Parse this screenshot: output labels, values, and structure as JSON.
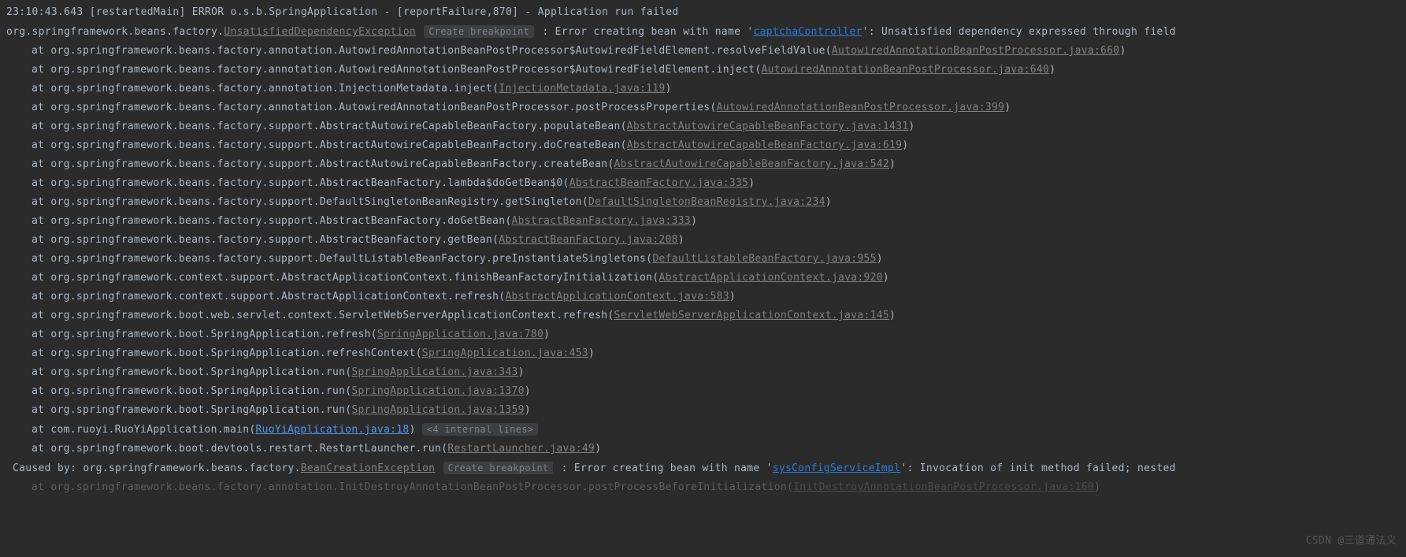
{
  "header": {
    "timestamp": "23:10:43.643",
    "thread": "[restartedMain]",
    "level": "ERROR",
    "logger": "o.s.b.SpringApplication",
    "dash": "-",
    "location": "[reportFailure,870]",
    "dash2": "-",
    "message": "Application run failed"
  },
  "exception_line": {
    "package": "org.springframework.beans.factory.",
    "exception_class": "UnsatisfiedDependencyException",
    "breakpoint": "Create breakpoint",
    "prefix": ": Error creating bean with name '",
    "bean_link": "captchaController",
    "suffix": "': Unsatisfied dependency expressed through field"
  },
  "stack": [
    {
      "pkg": "org.springframework.beans.factory.annotation.AutowiredAnnotationBeanPostProcessor$AutowiredFieldElement.resolveFieldValue(",
      "link": "AutowiredAnnotationBeanPostProcessor.java:660",
      "close": ")"
    },
    {
      "pkg": "org.springframework.beans.factory.annotation.AutowiredAnnotationBeanPostProcessor$AutowiredFieldElement.inject(",
      "link": "AutowiredAnnotationBeanPostProcessor.java:640",
      "close": ")"
    },
    {
      "pkg": "org.springframework.beans.factory.annotation.InjectionMetadata.inject(",
      "link": "InjectionMetadata.java:119",
      "close": ")"
    },
    {
      "pkg": "org.springframework.beans.factory.annotation.AutowiredAnnotationBeanPostProcessor.postProcessProperties(",
      "link": "AutowiredAnnotationBeanPostProcessor.java:399",
      "close": ")"
    },
    {
      "pkg": "org.springframework.beans.factory.support.AbstractAutowireCapableBeanFactory.populateBean(",
      "link": "AbstractAutowireCapableBeanFactory.java:1431",
      "close": ")"
    },
    {
      "pkg": "org.springframework.beans.factory.support.AbstractAutowireCapableBeanFactory.doCreateBean(",
      "link": "AbstractAutowireCapableBeanFactory.java:619",
      "close": ")"
    },
    {
      "pkg": "org.springframework.beans.factory.support.AbstractAutowireCapableBeanFactory.createBean(",
      "link": "AbstractAutowireCapableBeanFactory.java:542",
      "close": ")"
    },
    {
      "pkg": "org.springframework.beans.factory.support.AbstractBeanFactory.lambda$doGetBean$0(",
      "link": "AbstractBeanFactory.java:335",
      "close": ")"
    },
    {
      "pkg": "org.springframework.beans.factory.support.DefaultSingletonBeanRegistry.getSingleton(",
      "link": "DefaultSingletonBeanRegistry.java:234",
      "close": ")"
    },
    {
      "pkg": "org.springframework.beans.factory.support.AbstractBeanFactory.doGetBean(",
      "link": "AbstractBeanFactory.java:333",
      "close": ")"
    },
    {
      "pkg": "org.springframework.beans.factory.support.AbstractBeanFactory.getBean(",
      "link": "AbstractBeanFactory.java:208",
      "close": ")"
    },
    {
      "pkg": "org.springframework.beans.factory.support.DefaultListableBeanFactory.preInstantiateSingletons(",
      "link": "DefaultListableBeanFactory.java:955",
      "close": ")"
    },
    {
      "pkg": "org.springframework.context.support.AbstractApplicationContext.finishBeanFactoryInitialization(",
      "link": "AbstractApplicationContext.java:920",
      "close": ")"
    },
    {
      "pkg": "org.springframework.context.support.AbstractApplicationContext.refresh(",
      "link": "AbstractApplicationContext.java:583",
      "close": ")"
    },
    {
      "pkg": "org.springframework.boot.web.servlet.context.ServletWebServerApplicationContext.refresh(",
      "link": "ServletWebServerApplicationContext.java:145",
      "close": ")"
    },
    {
      "pkg": "org.springframework.boot.SpringApplication.refresh(",
      "link": "SpringApplication.java:780",
      "close": ")"
    },
    {
      "pkg": "org.springframework.boot.SpringApplication.refreshContext(",
      "link": "SpringApplication.java:453",
      "close": ")"
    },
    {
      "pkg": "org.springframework.boot.SpringApplication.run(",
      "link": "SpringApplication.java:343",
      "close": ")"
    },
    {
      "pkg": "org.springframework.boot.SpringApplication.run(",
      "link": "SpringApplication.java:1370",
      "close": ")"
    },
    {
      "pkg": "org.springframework.boot.SpringApplication.run(",
      "link": "SpringApplication.java:1359",
      "close": ")"
    }
  ],
  "user_frame": {
    "at": "at",
    "pkg": "com.ruoyi.RuoYiApplication.main(",
    "link": "RuoYiApplication.java:18",
    "close": ")",
    "internal": "<4 internal lines>"
  },
  "restart_frame": {
    "at": "at",
    "pkg": "org.springframework.boot.devtools.restart.RestartLauncher.run(",
    "link": "RestartLauncher.java:49",
    "close": ")"
  },
  "caused_by": {
    "prefix": "Caused by: org.springframework.beans.factory.",
    "exception_class": "BeanCreationException",
    "breakpoint": "Create breakpoint",
    "msg_prefix": ": Error creating bean with name '",
    "bean_link": "sysConfigServiceImpl",
    "msg_suffix": "': Invocation of init method failed; nested"
  },
  "last_frame": {
    "at": "at",
    "pkg": "org.springframework.beans.factory.annotation.InitDestroyAnnotationBeanPostProcessor.postProcessBeforeInitialization(",
    "link": "InitDestroyAnnotationBeanPostProcessor.java:160",
    "close": ")"
  },
  "watermark": "CSDN @三道通法义",
  "at_label": "at"
}
